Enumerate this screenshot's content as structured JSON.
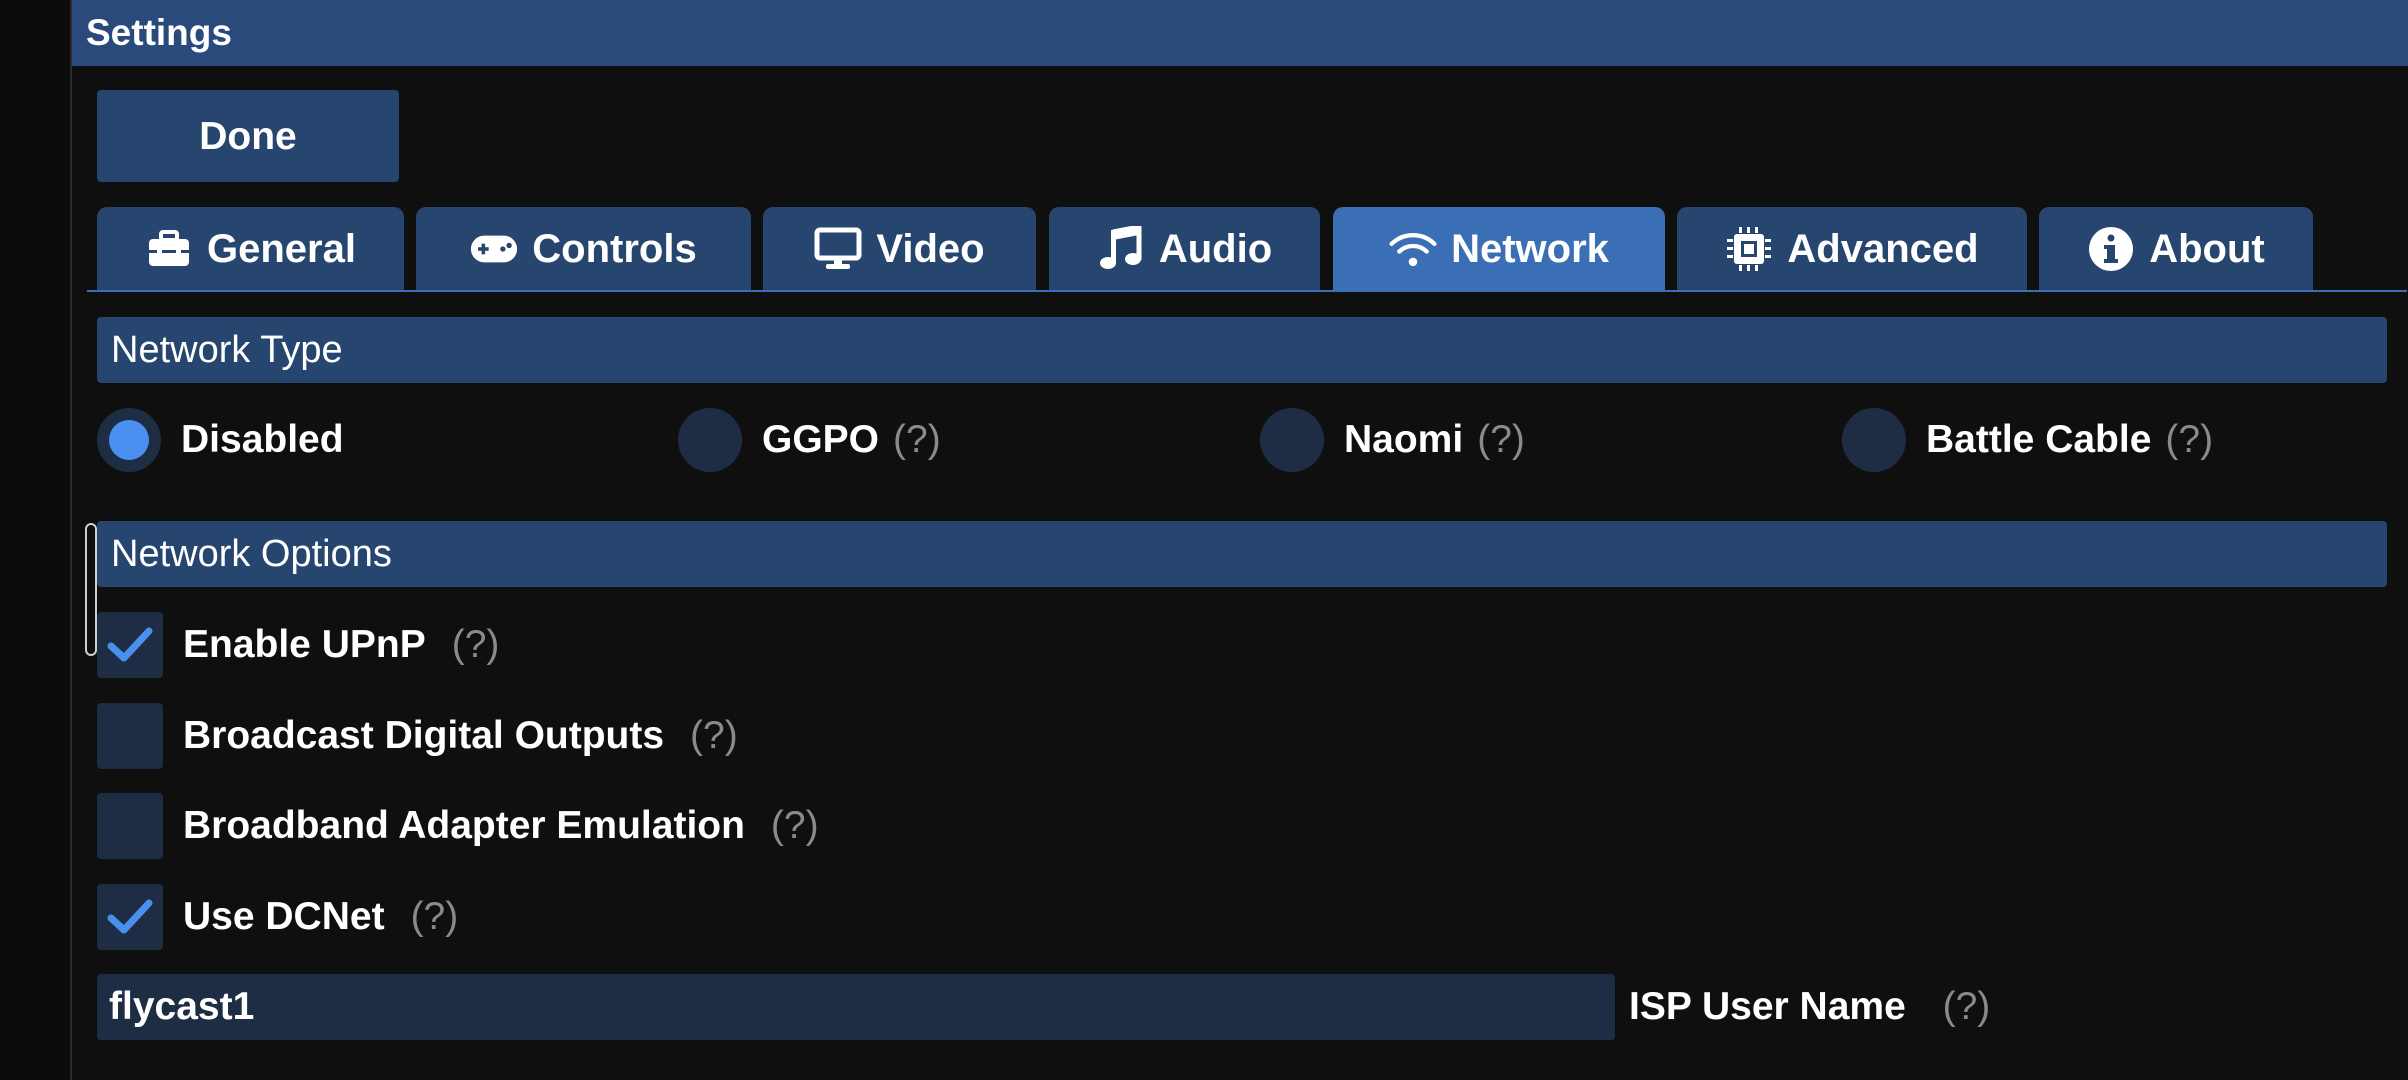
{
  "window": {
    "title": "Settings"
  },
  "toolbar": {
    "done_label": "Done"
  },
  "tabs": [
    {
      "label": "General",
      "icon": "toolbox-icon"
    },
    {
      "label": "Controls",
      "icon": "gamepad-icon"
    },
    {
      "label": "Video",
      "icon": "monitor-icon"
    },
    {
      "label": "Audio",
      "icon": "music-note-icon"
    },
    {
      "label": "Network",
      "icon": "wifi-icon",
      "active": true
    },
    {
      "label": "Advanced",
      "icon": "chip-icon"
    },
    {
      "label": "About",
      "icon": "info-icon"
    }
  ],
  "network_type": {
    "header": "Network Type",
    "options": [
      {
        "label": "Disabled",
        "help": "",
        "selected": true
      },
      {
        "label": "GGPO",
        "help": "(?)",
        "selected": false
      },
      {
        "label": "Naomi",
        "help": "(?)",
        "selected": false
      },
      {
        "label": "Battle Cable",
        "help": "(?)",
        "selected": false
      }
    ]
  },
  "network_options": {
    "header": "Network Options",
    "items": [
      {
        "label": "Enable UPnP",
        "help": "(?)",
        "checked": true
      },
      {
        "label": "Broadcast Digital Outputs",
        "help": "(?)",
        "checked": false
      },
      {
        "label": "Broadband Adapter Emulation",
        "help": "(?)",
        "checked": false
      },
      {
        "label": "Use DCNet",
        "help": "(?)",
        "checked": true
      }
    ],
    "isp_user_name": {
      "value": "flycast1",
      "label": "ISP User Name",
      "help": "(?)"
    }
  },
  "colors": {
    "titlebar": "#294a7a",
    "tab": "#27466f",
    "tab_active": "#3b6fb5",
    "control_bg": "#1e2d44",
    "accent": "#4a90f0"
  }
}
